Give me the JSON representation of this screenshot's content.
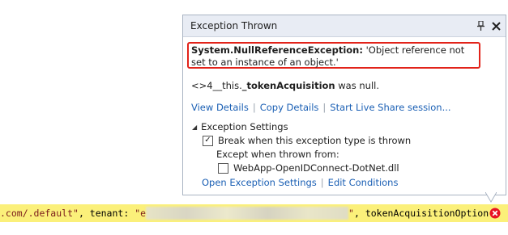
{
  "popup": {
    "title": "Exception Thrown",
    "exception_type": "System.NullReferenceException:",
    "exception_message": " 'Object reference not set to an instance of an object.'",
    "detail_prefix": "<>4__this.",
    "detail_field": "_tokenAcquisition",
    "detail_suffix": " was null.",
    "links": {
      "view_details": "View Details",
      "copy_details": "Copy Details",
      "live_share": "Start Live Share session..."
    },
    "settings": {
      "heading": "Exception Settings",
      "break_label": "Break when this exception type is thrown",
      "break_checked": true,
      "except_label": "Except when thrown from:",
      "module_label": "WebApp-OpenIDConnect-DotNet.dll",
      "module_checked": false
    },
    "bottom_links": {
      "open_settings": "Open Exception Settings",
      "edit_conditions": "Edit Conditions"
    }
  },
  "code": {
    "segment1": ".com/.default\"",
    "segment2": ", tenant: ",
    "segment3": "\"e",
    "segment4": "\"",
    "segment5": ", tokenAcquisitionOption:"
  },
  "colors": {
    "highlight_border": "#e2231a",
    "link": "#1a5fb4",
    "code_highlight": "#fbf07a",
    "error_icon": "#e81123"
  }
}
